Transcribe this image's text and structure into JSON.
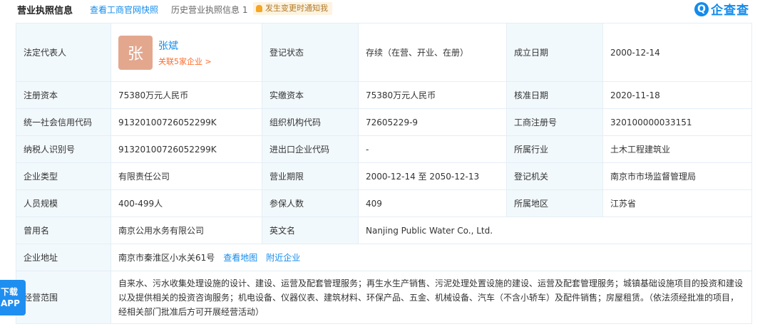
{
  "header": {
    "title": "营业执照信息",
    "link_official": "查看工商官网快照",
    "history": "历史营业执照信息 1",
    "notify": "发生变更时通知我"
  },
  "logo": {
    "mark": "Q",
    "name": "企查查"
  },
  "rep": {
    "avatar": "张",
    "name": "张斌",
    "sub": "关联5家企业 >"
  },
  "rows": {
    "r1": {
      "l1": "法定代表人",
      "l2": "登记状态",
      "v2": "存续（在营、开业、在册）",
      "l3": "成立日期",
      "v3": "2000-12-14"
    },
    "r2": {
      "l1": "注册资本",
      "v1": "75380万元人民币",
      "l2": "实缴资本",
      "v2": "75380万元人民币",
      "l3": "核准日期",
      "v3": "2020-11-18"
    },
    "r3": {
      "l1": "统一社会信用代码",
      "v1": "91320100726052299K",
      "l2": "组织机构代码",
      "v2": "72605229-9",
      "l3": "工商注册号",
      "v3": "320100000033151"
    },
    "r4": {
      "l1": "纳税人识别号",
      "v1": "91320100726052299K",
      "l2": "进出口企业代码",
      "v2": "-",
      "l3": "所属行业",
      "v3": "土木工程建筑业"
    },
    "r5": {
      "l1": "企业类型",
      "v1": "有限责任公司",
      "l2": "营业期限",
      "v2": "2000-12-14 至 2050-12-13",
      "l3": "登记机关",
      "v3": "南京市市场监督管理局"
    },
    "r6": {
      "l1": "人员规模",
      "v1": "400-499人",
      "l2": "参保人数",
      "v2": "409",
      "l3": "所属地区",
      "v3": "江苏省"
    },
    "r7": {
      "l1": "曾用名",
      "v1": "南京公用水务有限公司",
      "l2": "英文名",
      "v2": "Nanjing Public Water Co., Ltd."
    },
    "r8": {
      "l1": "企业地址",
      "v1": "南京市秦淮区小水关61号",
      "link_map": "查看地图",
      "link_nearby": "附近企业"
    },
    "r9": {
      "l1": "经营范围",
      "v1": "自来水、污水收集处理设施的设计、建设、运营及配套管理服务；再生水生产销售、污泥处理处置设施的建设、运营及配套管理服务；城镇基础设施项目的投资和建设以及提供相关的投资咨询服务；机电设备、仪器仪表、建筑材料、环保产品、五金、机械设备、汽车（不含小轿车）及配件销售；房屋租赁。（依法须经批准的项目，经相关部门批准后方可开展经营活动）"
    }
  },
  "float_button": {
    "line1": "下载",
    "line2": "APP"
  }
}
